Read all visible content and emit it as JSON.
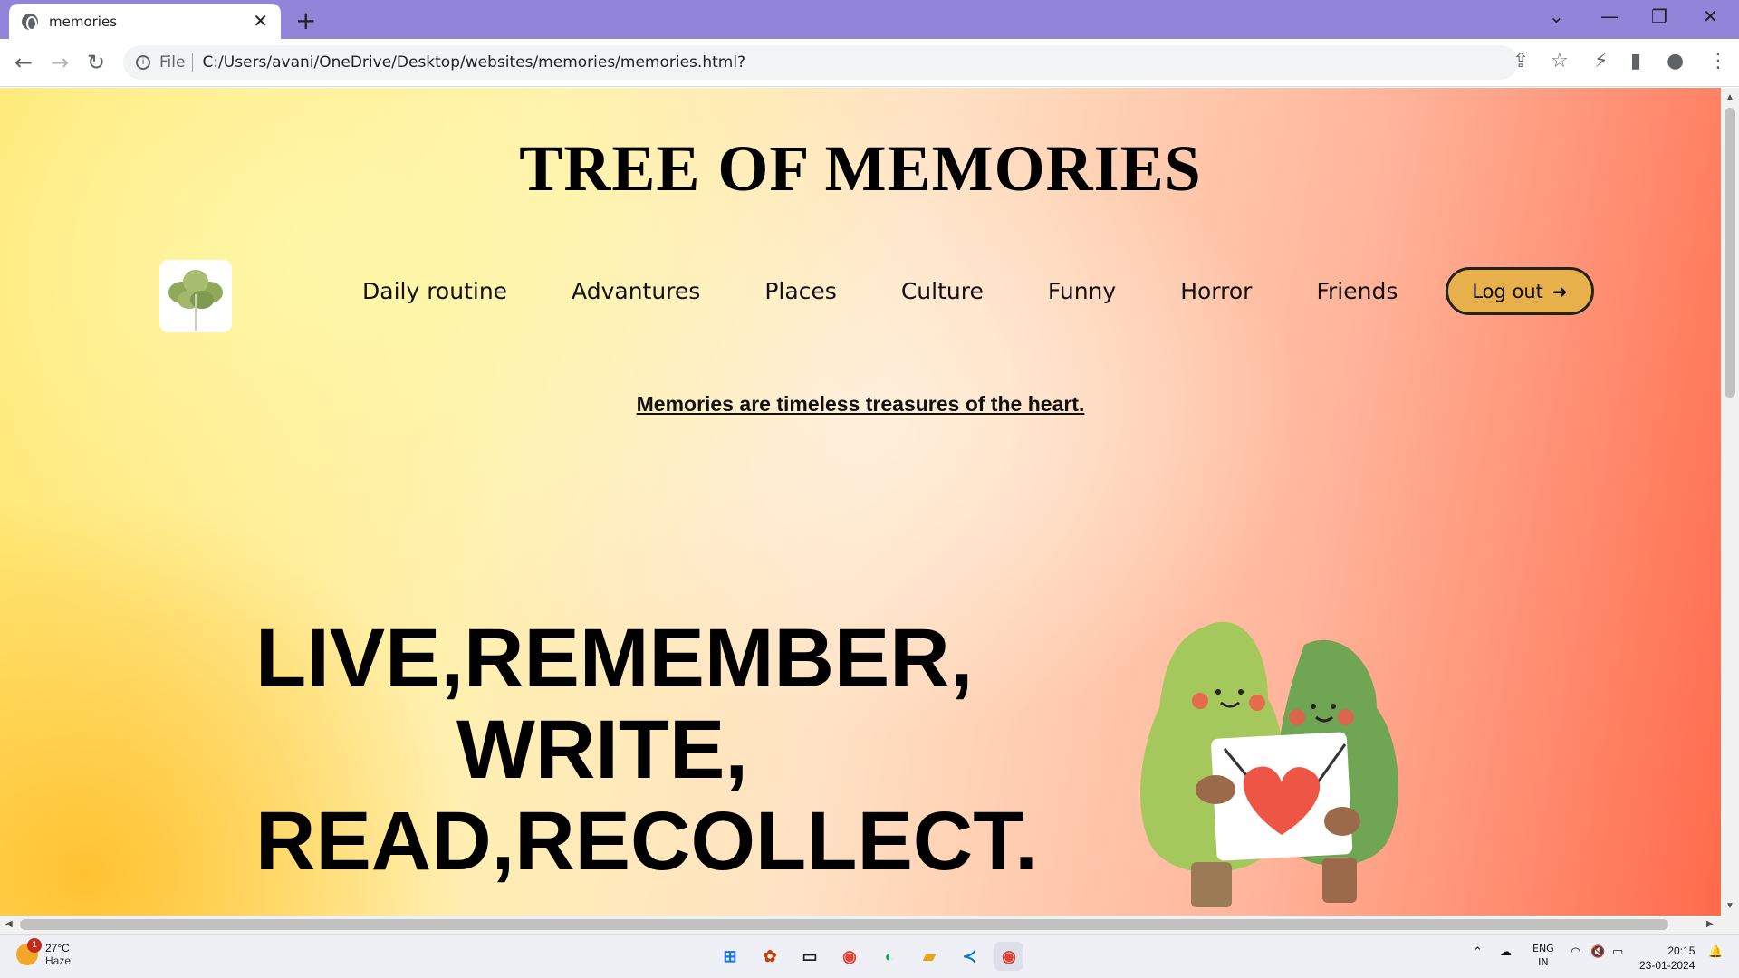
{
  "browser": {
    "tab_title": "memories",
    "new_tab": "+",
    "url_scheme": "File",
    "url": "C:/Users/avani/OneDrive/Desktop/websites/memories/memories.html?"
  },
  "page": {
    "title": "TREE OF MEMORIES",
    "nav": [
      "Daily routine",
      "Advantures",
      "Places",
      "Culture",
      "Funny",
      "Horror",
      "Friends"
    ],
    "logout_label": "Log out",
    "tagline": "Memories are timeless treasures of the heart.",
    "hero": [
      "LIVE,REMEMBER,",
      "WRITE,",
      "READ,RECOLLECT."
    ]
  },
  "taskbar": {
    "weather_temp": "27°C",
    "weather_desc": "Haze",
    "notification_count": "1",
    "lang": "ENG",
    "region": "IN",
    "time": "20:15",
    "date": "23-01-2024"
  },
  "colors": {
    "tabbar": "#9184d9",
    "logout_bg": "#e8b04a"
  }
}
